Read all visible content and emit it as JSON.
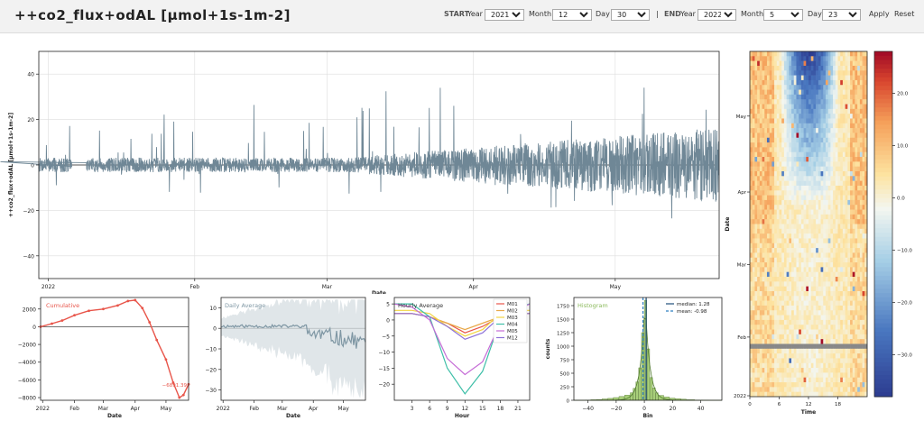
{
  "header": {
    "title": "++co2_flux+odAL [µmol+1s-1m-2]",
    "start_label": "START",
    "end_label": "END",
    "separator": "|",
    "year_label": "Year",
    "month_label": "Month",
    "day_label": "Day",
    "start": {
      "year": "2021",
      "month": "12",
      "day": "30"
    },
    "end": {
      "year": "2022",
      "month": "5",
      "day": "23"
    },
    "apply_label": "Apply",
    "reset_label": "Reset"
  },
  "colors": {
    "series": "#6f8796",
    "cumulative": "#e8554a",
    "daily": "#7f97a4",
    "histogram": "#a8cf7a",
    "histogram_label": "#8ab95a",
    "median_line": "#1f4e79",
    "mean_line": "#2f7fc1"
  },
  "chart_data": [
    {
      "type": "line",
      "name": "timeseries",
      "xlabel": "Date",
      "ylabel": "++co2_flux+odAL [µmol+1s-1m-2]",
      "xticks": [
        "2022",
        "Feb",
        "Mar",
        "Apr",
        "May"
      ],
      "yticks": [
        "40",
        "20",
        "0",
        "−20",
        "−40"
      ],
      "ylim": [
        -50,
        50
      ],
      "x_range": [
        "2021-12-30",
        "2022-05-23"
      ],
      "grid": true
    },
    {
      "type": "line",
      "name": "cumulative",
      "label": "Cumulative",
      "xlabel": "Date",
      "xticks": [
        "2022",
        "Feb",
        "Mar",
        "Apr",
        "May"
      ],
      "yticks": [
        "2000",
        "0",
        "−2000",
        "−4000",
        "−6000",
        "−8000"
      ],
      "ylim": [
        -8300,
        3300
      ],
      "x": [
        "2021-12-30",
        "2022-01-10",
        "2022-01-20",
        "2022-02-01",
        "2022-02-15",
        "2022-03-01",
        "2022-03-15",
        "2022-03-25",
        "2022-04-01",
        "2022-04-08",
        "2022-04-15",
        "2022-04-22",
        "2022-05-01",
        "2022-05-08",
        "2022-05-14",
        "2022-05-18",
        "2022-05-23"
      ],
      "values": [
        0,
        350,
        700,
        1300,
        1800,
        2000,
        2400,
        2900,
        3000,
        2100,
        500,
        -1500,
        -3700,
        -6300,
        -8000,
        -7700,
        -6500
      ],
      "annotation": "−6891.39"
    },
    {
      "type": "line",
      "name": "daily_average",
      "label": "Daily Average",
      "xlabel": "Date",
      "xticks": [
        "2022",
        "Feb",
        "Mar",
        "Apr",
        "May"
      ],
      "yticks": [
        "10",
        "0",
        "−10",
        "−20",
        "−30"
      ],
      "ylim": [
        -35,
        15
      ]
    },
    {
      "type": "line",
      "name": "hourly_average",
      "label": "Hourly Average",
      "xlabel": "Hour",
      "xticks": [
        "3",
        "6",
        "9",
        "12",
        "15",
        "18",
        "21"
      ],
      "yticks": [
        "5",
        "0",
        "−5",
        "−10",
        "−15",
        "−20"
      ],
      "ylim": [
        -25,
        7
      ],
      "x": [
        0,
        3,
        6,
        9,
        12,
        15,
        18,
        21,
        23
      ],
      "series": [
        {
          "name": "M01",
          "color": "#e8554a",
          "values": [
            2,
            2,
            1,
            -1,
            -4,
            -2,
            1,
            2,
            2
          ]
        },
        {
          "name": "M02",
          "color": "#e8a848",
          "values": [
            2,
            2,
            1,
            -1,
            -3,
            -1,
            1,
            2,
            2
          ]
        },
        {
          "name": "M03",
          "color": "#f2d542",
          "values": [
            3,
            3,
            2,
            -2,
            -5,
            -3,
            2,
            3,
            3
          ]
        },
        {
          "name": "M04",
          "color": "#3fbfa8",
          "values": [
            5,
            5,
            1,
            -15,
            -23,
            -16,
            0,
            4,
            5
          ]
        },
        {
          "name": "M05",
          "color": "#c56bd6",
          "values": [
            5,
            4,
            0,
            -12,
            -17,
            -13,
            -1,
            3,
            5
          ]
        },
        {
          "name": "M12",
          "color": "#8e72d8",
          "values": [
            2,
            2,
            1,
            -2,
            -6,
            -4,
            1,
            2,
            2
          ]
        }
      ]
    },
    {
      "type": "bar",
      "name": "histogram",
      "label": "Histogram",
      "xlabel": "Bin",
      "ylabel": "counts",
      "xticks": [
        "−40",
        "−20",
        "0",
        "20",
        "40"
      ],
      "yticks": [
        "1750",
        "1500",
        "1250",
        "1000",
        "750",
        "500",
        "250",
        "0"
      ],
      "ylim": [
        0,
        1900
      ],
      "xlim": [
        -50,
        55
      ],
      "bins": [
        -42,
        -38,
        -34,
        -30,
        -26,
        -22,
        -18,
        -14,
        -10,
        -8,
        -6,
        -4,
        -2,
        0,
        2,
        4,
        6,
        8,
        10,
        14,
        18,
        22,
        26,
        30,
        36,
        42
      ],
      "values": [
        5,
        10,
        15,
        25,
        35,
        50,
        70,
        95,
        140,
        220,
        340,
        600,
        1250,
        1850,
        950,
        420,
        230,
        140,
        90,
        60,
        40,
        30,
        20,
        10,
        5,
        2
      ],
      "median_label": "median: 1.28",
      "mean_label": "mean: -0.98",
      "median": 1.28,
      "mean": -0.98
    },
    {
      "type": "heatmap",
      "name": "fingerprint",
      "xlabel": "Time",
      "ylabel": "Date",
      "xticks": [
        "0",
        "6",
        "12",
        "18"
      ],
      "yticks": [
        "May",
        "Apr",
        "Mar",
        "Feb",
        "2022"
      ],
      "colorbar_ticks": [
        "20.0",
        "10.0",
        "0.0",
        "−10.0",
        "−20.0",
        "−30.0"
      ],
      "vmin": -38,
      "vmax": 28
    }
  ]
}
